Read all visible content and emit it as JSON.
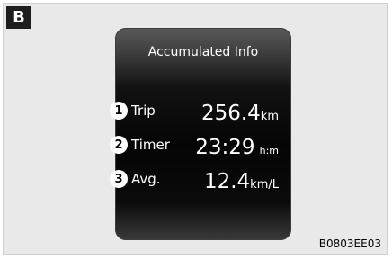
{
  "figure_label": "B",
  "screen": {
    "title": "Accumulated Info",
    "rows": [
      {
        "badge": "1",
        "label": "Trip",
        "value": "256.4",
        "unit": "km"
      },
      {
        "badge": "2",
        "label": "Timer",
        "value": "23:29",
        "unit": "h:m"
      },
      {
        "badge": "3",
        "label": "Avg.",
        "value": "12.4",
        "unit": "km/L"
      }
    ]
  },
  "caption": "B0803EE03"
}
